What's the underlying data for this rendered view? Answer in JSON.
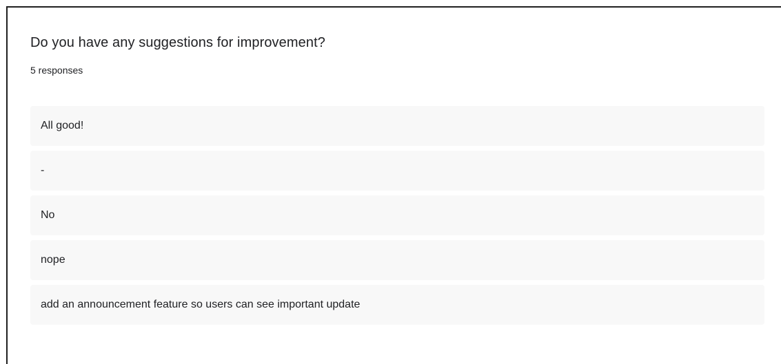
{
  "question": {
    "title": "Do you have any suggestions for improvement?",
    "response_count": "5 responses"
  },
  "responses": [
    "All good!",
    "-",
    "No",
    "nope",
    "add an announcement feature so users can see important update"
  ]
}
